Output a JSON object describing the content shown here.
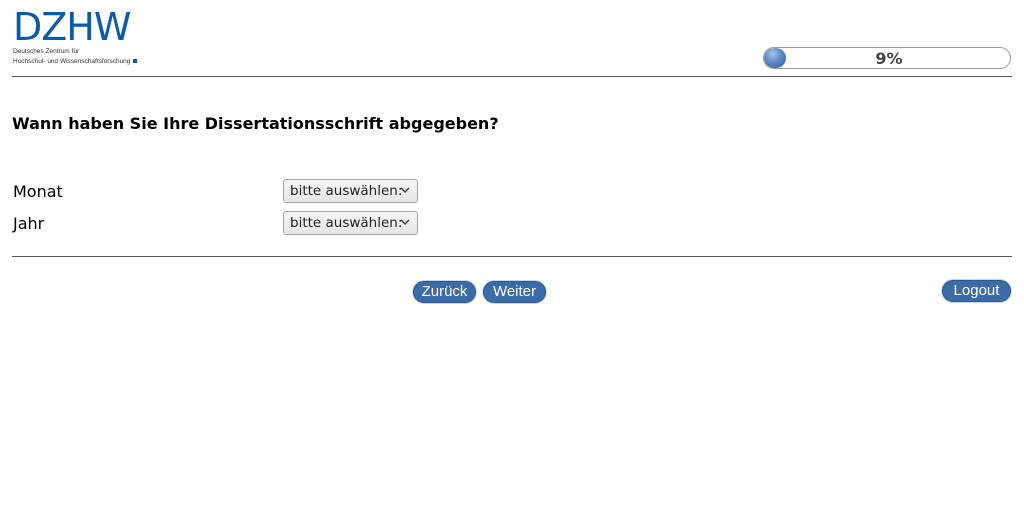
{
  "logo": {
    "mark": "DZHW",
    "line1": "Deutsches Zentrum für",
    "line2": "Hochschul- und Wissenschaftsforschung"
  },
  "progress": {
    "percent": 9,
    "label": "9%",
    "color": "#3c6ca8"
  },
  "question": {
    "text": "Wann haben Sie Ihre Dissertationsschrift abgegeben?"
  },
  "fields": {
    "month": {
      "label": "Monat",
      "selected": "bitte auswählen:"
    },
    "year": {
      "label": "Jahr",
      "selected": "bitte auswählen:"
    }
  },
  "nav": {
    "back_label": "Zurück",
    "next_label": "Weiter",
    "logout_label": "Logout"
  },
  "icons": {
    "select_arrow": "chevron-down-icon"
  }
}
